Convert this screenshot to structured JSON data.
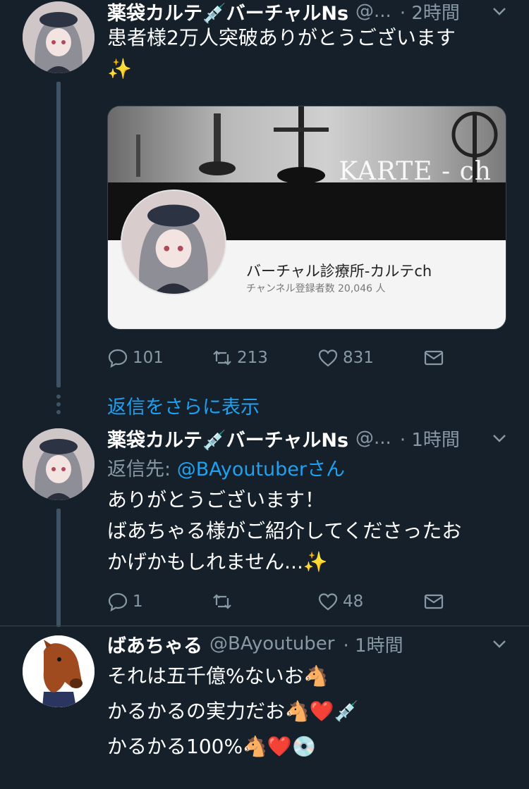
{
  "tweet1": {
    "name": "薬袋カルテ💉バーチャルNs",
    "handle": "@...",
    "time": "· 2時間",
    "text": "患者様2万人突破ありがとうございます\n✨",
    "card": {
      "banner_title": "KARTE - ch",
      "channel_name": "バーチャル診療所-カルテch",
      "subscribers": "チャンネル登録者数 20,046 人"
    },
    "replies": "101",
    "retweets": "213",
    "likes": "831"
  },
  "more_replies": "返信をさらに表示",
  "tweet2": {
    "name": "薬袋カルテ💉バーチャルNs",
    "handle": "@...",
    "time": "· 1時間",
    "reply_prefix": "返信先: ",
    "reply_to": "@BAyoutuberさん",
    "text": "ありがとうございます！\nばあちゃる様がご紹介してくださったお\nかげかもしれません...✨",
    "replies": "1",
    "retweets": "",
    "likes": "48"
  },
  "tweet3": {
    "name": "ばあちゃる",
    "handle": "@BAyoutuber",
    "time": "· 1時間",
    "line1": "それは五千億%ないお🐴",
    "line2": "かるかるの実力だお🐴❤️💉",
    "line3": "かるかる100%🐴❤️💿"
  },
  "colors": {
    "background": "#15202b",
    "secondary_text": "#8899a6",
    "link": "#1da1f2",
    "thread_line": "#3d5466"
  }
}
